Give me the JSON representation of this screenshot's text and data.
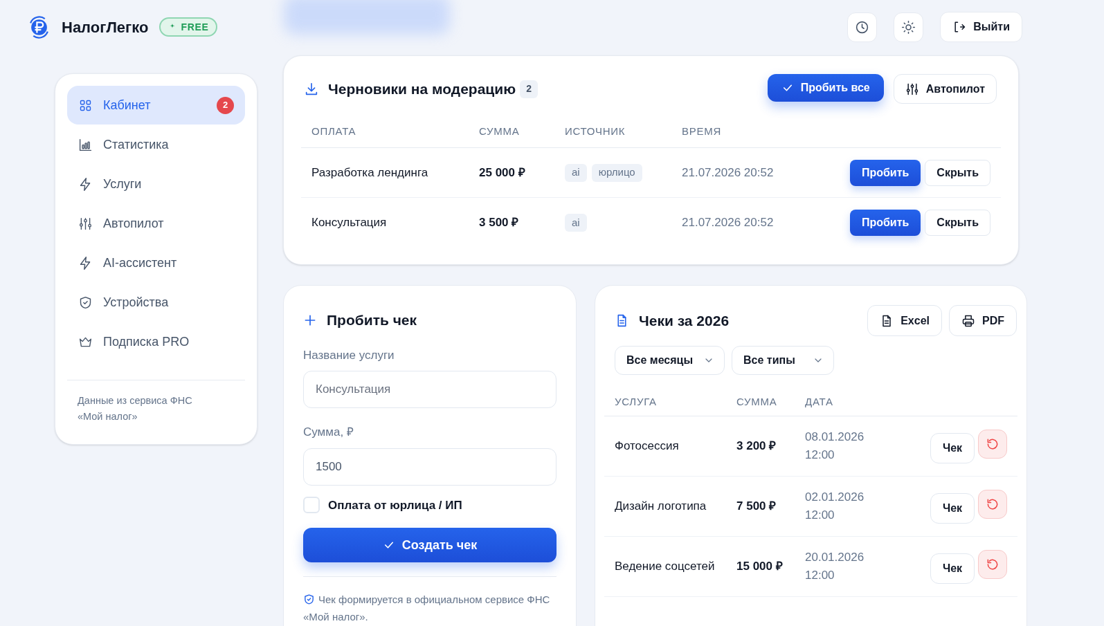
{
  "header": {
    "app_name": "НалогЛегко",
    "plan_badge": "FREE",
    "logout_button": "Выйти"
  },
  "sidebar": {
    "items": [
      {
        "label": "Кабинет",
        "selected": true,
        "badge": "2"
      },
      {
        "label": "Статистика",
        "selected": false
      },
      {
        "label": "Услуги",
        "selected": false
      },
      {
        "label": "Автопилот",
        "selected": false
      },
      {
        "label": "AI-ассистент",
        "selected": false
      },
      {
        "label": "Устройства",
        "selected": false
      },
      {
        "label": "Подписка PRO",
        "selected": false
      }
    ],
    "footnote": "Данные из сервиса ФНС «Мой налог»"
  },
  "drafts": {
    "title": "Черновики на модерацию",
    "count": "2",
    "buttons": [
      "Пробить все",
      "Автопилот"
    ],
    "columns": [
      "ОПЛАТА",
      "СУММА",
      "ИСТОЧНИК",
      "ВРЕМЯ"
    ],
    "rows": [
      {
        "payment": "Разработка лендинга",
        "amount": "25 000 ₽",
        "tags": [
          "ai",
          "юрлицо"
        ],
        "time": "21.07.2026 20:52",
        "actions": [
          "Пробить",
          "Скрыть"
        ]
      },
      {
        "payment": "Консультация",
        "amount": "3 500 ₽",
        "tags": [
          "ai"
        ],
        "time": "21.07.2026 20:52",
        "actions": [
          "Пробить",
          "Скрыть"
        ]
      }
    ]
  },
  "create_receipt": {
    "title": "Пробить чек",
    "fields": [
      {
        "label": "Название услуги",
        "placeholder": "Консультация"
      },
      {
        "label": "Сумма, ₽",
        "value": "1500"
      }
    ],
    "checkbox": {
      "label": "Оплата от юрлица / ИП",
      "checked": false
    },
    "submit": "Создать чек",
    "note": "Чек формируется в официальном сервисе ФНС «Мой налог»."
  },
  "receipts": {
    "title": "Чеки за 2026",
    "exports": [
      "Excel",
      "PDF"
    ],
    "filters": [
      "Все месяцы",
      "Все типы"
    ],
    "columns": [
      "УСЛУГА",
      "СУММА",
      "ДАТА"
    ],
    "rows": [
      {
        "service": "Фотосессия",
        "amount": "3 200 ₽",
        "date": "08.01.2026 12:00",
        "action": "Чек"
      },
      {
        "service": "Дизайн логотипа",
        "amount": "7 500 ₽",
        "date": "02.01.2026 12:00",
        "action": "Чек"
      },
      {
        "service": "Ведение соцсетей",
        "amount": "15 000 ₽",
        "date": "20.01.2026 12:00",
        "action": "Чек"
      }
    ]
  }
}
